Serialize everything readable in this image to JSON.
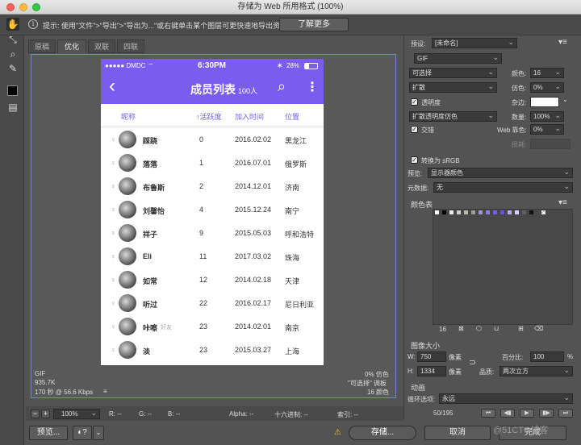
{
  "window": {
    "title": "存储为 Web 所用格式 (100%)"
  },
  "tipbar": {
    "info_glyph": "i",
    "text": "提示: 使用\"文件\">\"导出\">\"导出为...\"或右键单击某个图层可更快速地导出资源",
    "learn_more": "了解更多"
  },
  "view_tabs": [
    "原稿",
    "优化",
    "双联",
    "四联"
  ],
  "phone": {
    "status": {
      "carrier": "●●●●● DMDC ",
      "time": "6:30PM",
      "battery": "28%"
    },
    "nav": {
      "title": "成员列表",
      "count": "100人",
      "back": "‹",
      "search": "⌕",
      "more": "⋮"
    },
    "columns": [
      "昵称",
      "↑活跃度",
      "加入时间",
      "位置"
    ],
    "rows": [
      {
        "gender": "♀",
        "name": "踩跷",
        "tag": "",
        "activity": "0",
        "date": "2016.02.02",
        "location": "黑龙江"
      },
      {
        "gender": "♀",
        "name": "落落",
        "tag": "",
        "activity": "1",
        "date": "2016.07.01",
        "location": "俄罗斯"
      },
      {
        "gender": "♀",
        "name": "布鲁斯",
        "tag": "",
        "activity": "2",
        "date": "2014.12.01",
        "location": "济南"
      },
      {
        "gender": "♀",
        "name": "刘馨怡",
        "tag": "",
        "activity": "4",
        "date": "2015.12.24",
        "location": "南宁"
      },
      {
        "gender": "♀",
        "name": "祥子",
        "tag": "",
        "activity": "9",
        "date": "2015.05.03",
        "location": "呼和浩特"
      },
      {
        "gender": "♀",
        "name": "Eli",
        "tag": "",
        "activity": "11",
        "date": "2017.03.02",
        "location": "珠海"
      },
      {
        "gender": "♀",
        "name": "如常",
        "tag": "",
        "activity": "12",
        "date": "2014.02.18",
        "location": "天津"
      },
      {
        "gender": "♀",
        "name": "听过",
        "tag": "",
        "activity": "22",
        "date": "2016.02.17",
        "location": "尼日利亚"
      },
      {
        "gender": "♀",
        "name": "咔嚓",
        "tag": "好友",
        "activity": "23",
        "date": "2014.02.01",
        "location": "南京"
      },
      {
        "gender": "♀",
        "name": "淡",
        "tag": "",
        "activity": "23",
        "date": "2015.03.27",
        "location": "上海"
      }
    ]
  },
  "canvas_info": {
    "format": "GIF",
    "size": "935.7K",
    "time": "170 秒 @ 56.6 Kbps",
    "menu": "≡",
    "dither": "0% 仿色",
    "palette": "\"可选择\" 调板",
    "colors": "16 颜色"
  },
  "bottom_bar": {
    "zoom": "100%",
    "r": "R: --",
    "g": "G: --",
    "b": "B: --",
    "alpha": "Alpha: --",
    "hex": "十六进制: --",
    "index": "索引: --"
  },
  "footer": {
    "preview": "预览...",
    "save": "存储...",
    "cancel": "取消",
    "done": "完成",
    "warning": "⚠"
  },
  "settings": {
    "preset_label": "预设:",
    "preset_value": "[未命名]",
    "format": "GIF",
    "reduction": "可选择",
    "colors_label": "颜色:",
    "colors_value": "16",
    "dither_algo": "扩散",
    "dither_label": "仿色:",
    "dither_value": "0%",
    "transparency": "透明度",
    "matte_label": "杂边:",
    "trans_dither": "扩散透明度仿色",
    "amount_label": "数量:",
    "amount_value": "100%",
    "interlaced": "交错",
    "websnap_label": "Web 靠色:",
    "websnap_value": "0%",
    "lossy_label": "损耗:",
    "srgb": "转换为 sRGB",
    "preview_label": "预览:",
    "preview_value": "显示器颜色",
    "metadata_label": "元数据:",
    "metadata_value": "无",
    "color_table_title": "颜色表",
    "color_table_count": "16",
    "swatches": [
      "#ffffff",
      "#000000",
      "#e8e8e8",
      "#cfcfcf",
      "#bdb6ab",
      "#a19e98",
      "#9f93c8",
      "#8a7de0",
      "#7a5cf0",
      "#6b4fe0",
      "#b8aef0",
      "#d8d2f4",
      "#5f5f5f",
      "#111111"
    ],
    "image_size_title": "图像大小",
    "w_label": "W:",
    "w_value": "750",
    "h_label": "H:",
    "h_value": "1334",
    "unit": "像素",
    "percent_label": "百分比:",
    "percent_value": "100",
    "percent_unit": "%",
    "quality_label": "品质:",
    "quality_value": "两次立方",
    "animation_title": "动画",
    "loop_label": "循环选项:",
    "loop_value": "永远",
    "frame_counter": "50/195"
  },
  "watermark": "@51CTO博客",
  "accent_color": "#7a5cf0"
}
